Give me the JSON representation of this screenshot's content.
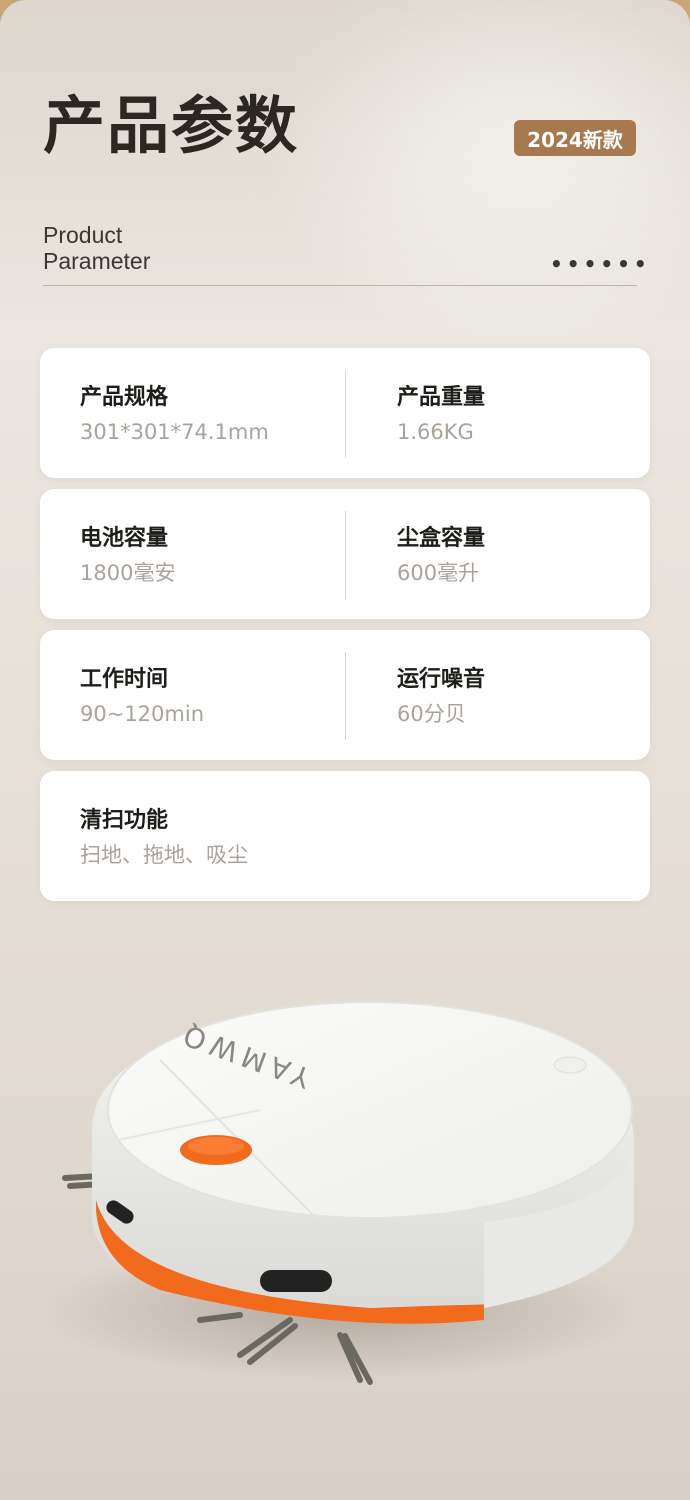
{
  "header": {
    "title": "产品参数",
    "badge": "2024新款",
    "subtitle_line1": "Product",
    "subtitle_line2": "Parameter",
    "dots": "••••••"
  },
  "specs": [
    {
      "left": {
        "label": "产品规格",
        "value": "301*301*74.1mm"
      },
      "right": {
        "label": "产品重量",
        "value": "1.66KG"
      }
    },
    {
      "left": {
        "label": "电池容量",
        "value": "1800毫安"
      },
      "right": {
        "label": "尘盒容量",
        "value": "600毫升"
      }
    },
    {
      "left": {
        "label": "工作时间",
        "value": "90~120min"
      },
      "right": {
        "label": "运行噪音",
        "value": "60分贝"
      }
    },
    {
      "left": {
        "label": "清扫功能",
        "value": "扫地、拖地、吸尘"
      }
    }
  ],
  "product": {
    "brand_text": "YAMWQ",
    "accent_color": "#f26a1b"
  }
}
